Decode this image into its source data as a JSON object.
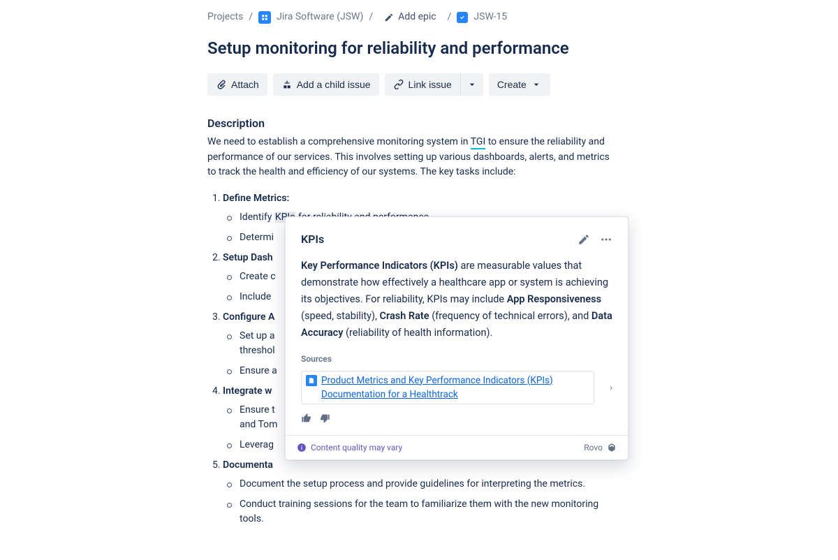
{
  "breadcrumb": {
    "projects": "Projects",
    "project_name": "Jira Software (JSW)",
    "add_epic": "Add epic",
    "issue_key": "JSW-15"
  },
  "title": "Setup monitoring for reliability and performance",
  "toolbar": {
    "attach": "Attach",
    "add_child": "Add a child issue",
    "link": "Link issue",
    "create": "Create"
  },
  "description": {
    "heading": "Description",
    "text_pre": "We need to establish a comprehensive monitoring system in ",
    "tgi": "TGI",
    "text_post": " to ensure the reliability and performance of our services. This involves setting up various dashboards, alerts, and metrics to track the health and efficiency of our systems. The key tasks include:"
  },
  "tasks": [
    {
      "head": "Define Metrics:",
      "items": [
        {
          "pre": "Identify ",
          "hl": "KPIs",
          "post": " for reliability and performance."
        },
        {
          "text": "Determi"
        }
      ]
    },
    {
      "head": "Setup Dash",
      "items": [
        {
          "text": "Create c"
        },
        {
          "text": "Include "
        }
      ]
    },
    {
      "head": "Configure A",
      "items": [
        {
          "text": "Set up a",
          "line2": "threshol"
        },
        {
          "text": "Ensure a"
        }
      ]
    },
    {
      "head": "Integrate w",
      "items": [
        {
          "text": "Ensure t",
          "line2": "and Tom"
        },
        {
          "text": "Leverag"
        }
      ]
    },
    {
      "head": "Documenta",
      "items": [
        {
          "text": "Document the setup process and provide guidelines for interpreting the metrics."
        },
        {
          "text": "Conduct training sessions for the team to familiarize them with the new monitoring tools."
        }
      ]
    }
  ],
  "popover": {
    "title": "KPIs",
    "body": {
      "b1": "Key Performance Indicators (KPIs)",
      "t1": " are measurable values that demonstrate how effectively a healthcare app or system is achieving its objectives. For reliability, KPIs may include ",
      "b2": "App Responsiveness",
      "t2": " (speed, stability), ",
      "b3": "Crash Rate",
      "t3": " (frequency of technical errors), and ",
      "b4": "Data Accuracy",
      "t4": " (reliability of health information)."
    },
    "sources_label": "Sources",
    "source_link": "Product Metrics and Key Performance Indicators (KPIs) Documentation for a Healthtrack",
    "quality": "Content quality may vary",
    "brand": "Rovo"
  }
}
